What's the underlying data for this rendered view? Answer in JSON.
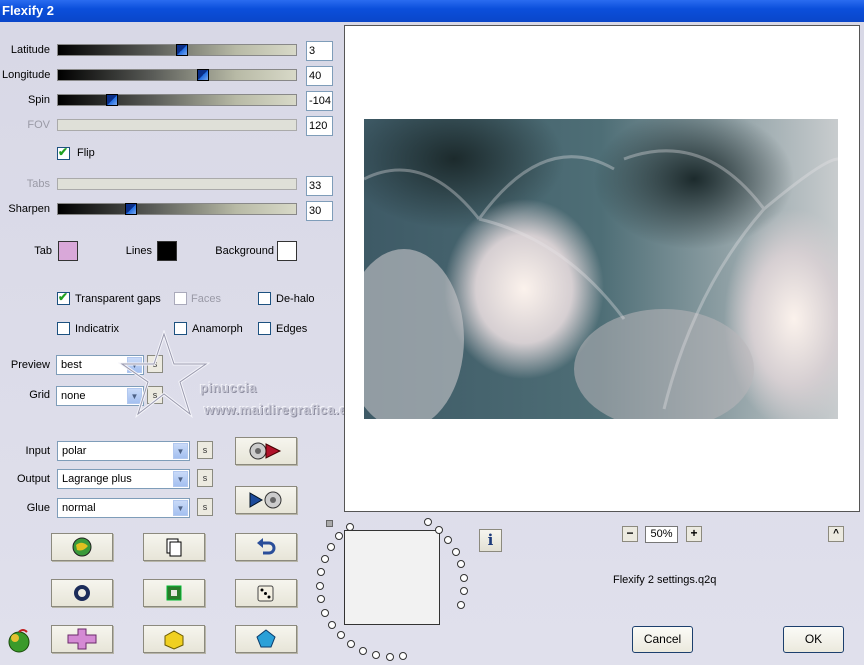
{
  "window": {
    "title": "Flexify 2"
  },
  "sliders": [
    {
      "label": "Latitude",
      "value": "3",
      "level": 0.53,
      "enabled": true
    },
    {
      "label": "Longitude",
      "value": "40",
      "level": 0.61,
      "enabled": true
    },
    {
      "label": "Spin",
      "value": "-104",
      "level": 0.21,
      "enabled": true
    },
    {
      "label": "FOV",
      "value": "120",
      "level": null,
      "enabled": false
    }
  ],
  "flip": {
    "label": "Flip",
    "checked": true
  },
  "sliders2": [
    {
      "label": "Tabs",
      "value": "33",
      "level": null,
      "enabled": false
    },
    {
      "label": "Sharpen",
      "value": "30",
      "level": 0.3,
      "enabled": true
    }
  ],
  "colors": {
    "tab": {
      "label": "Tab",
      "color": "#d9a8d9"
    },
    "lines": {
      "label": "Lines",
      "color": "#000000"
    },
    "background": {
      "label": "Background",
      "color": "#ffffff"
    }
  },
  "options": {
    "transparent_gaps": {
      "label": "Transparent gaps",
      "checked": true
    },
    "faces": {
      "label": "Faces",
      "checked": false,
      "enabled": false
    },
    "dehalo": {
      "label": "De-halo",
      "checked": false
    },
    "indicatrix": {
      "label": "Indicatrix",
      "checked": false
    },
    "anamorph": {
      "label": "Anamorph",
      "checked": false
    },
    "edges": {
      "label": "Edges",
      "checked": false
    }
  },
  "preview_select": {
    "label": "Preview",
    "value": "best"
  },
  "grid_select": {
    "label": "Grid",
    "value": "none"
  },
  "input_select": {
    "label": "Input",
    "value": "polar"
  },
  "output_select": {
    "label": "Output",
    "value": "Lagrange plus"
  },
  "glue_select": {
    "label": "Glue",
    "value": "normal"
  },
  "s_button": "s",
  "watermark": {
    "name": "pinuccia",
    "site": "www.maidiregrafica.eu"
  },
  "zoom": {
    "value": "50%",
    "minus": "−",
    "plus": "+",
    "up": "^"
  },
  "settings_file": "Flexify 2 settings.q2q",
  "info_label": "i",
  "buttons": {
    "cancel": "Cancel",
    "ok": "OK"
  }
}
